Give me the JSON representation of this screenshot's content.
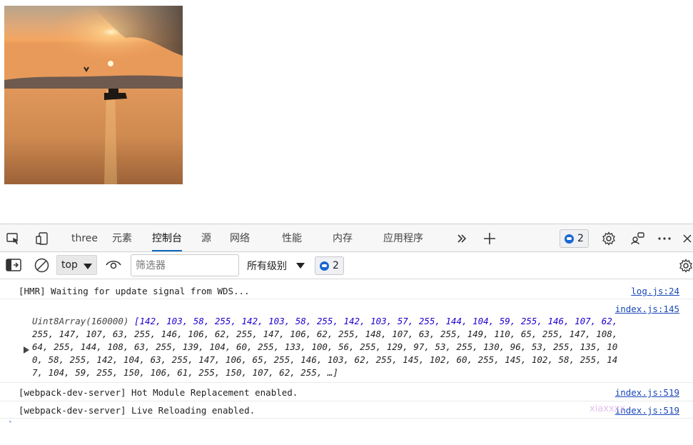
{
  "devtools": {
    "tabs": [
      {
        "label": "three"
      },
      {
        "label": "元素"
      },
      {
        "label": "控制台",
        "active": true
      },
      {
        "label": "源"
      },
      {
        "label": "网络"
      },
      {
        "label": "性能"
      },
      {
        "label": "内存"
      },
      {
        "label": "应用程序"
      }
    ],
    "issues_count": "2",
    "icons": {
      "inspect": "inspect-element-icon",
      "device": "device-emulation-icon",
      "more_tabs": "chevron-double-right-icon",
      "add_tab": "plus-icon",
      "settings": "gear-icon",
      "feedback": "feedback-icon",
      "more": "ellipsis-icon",
      "close": "close-icon"
    }
  },
  "console_toolbar": {
    "context": "top",
    "filter_placeholder": "筛选器",
    "level": "所有级别",
    "issues_count": "2"
  },
  "messages": [
    {
      "text": "[HMR] Waiting for update signal from WDS...",
      "source": "log.js:24"
    },
    {
      "source": "index.js:145",
      "array_type": "Uint8Array(160000)",
      "array_lines": [
        "[142, 103, 58, 255, 142, 103, 58, 255, 142, 103, 57, 255, 144, 104, 59, 255, 146, 107, 62,",
        "255, 147, 107, 63, 255, 146, 106, 62, 255, 147, 106, 62, 255, 148, 107, 63, 255, 149, 110, 65, 255, 147, 108,",
        "64, 255, 144, 108, 63, 255, 139, 104, 60, 255, 133, 100, 56, 255, 129, 97, 53, 255, 130, 96, 53, 255, 135, 10",
        "0, 58, 255, 142, 104, 63, 255, 147, 106, 65, 255, 146, 103, 62, 255, 145, 102, 60, 255, 145, 102, 58, 255, 14",
        "7, 104, 59, 255, 150, 106, 61, 255, 150, 107, 62, 255, …]"
      ]
    },
    {
      "text": "[webpack-dev-server] Hot Module Replacement enabled.",
      "source": "index.js:519"
    },
    {
      "text": "[webpack-dev-server] Live Reloading enabled.",
      "source": "index.js:519"
    }
  ],
  "watermark": "xiaxxxx",
  "colors": {
    "accent": "#0f6cbd",
    "link": "#1a47b8",
    "number": "#1c00cf"
  }
}
